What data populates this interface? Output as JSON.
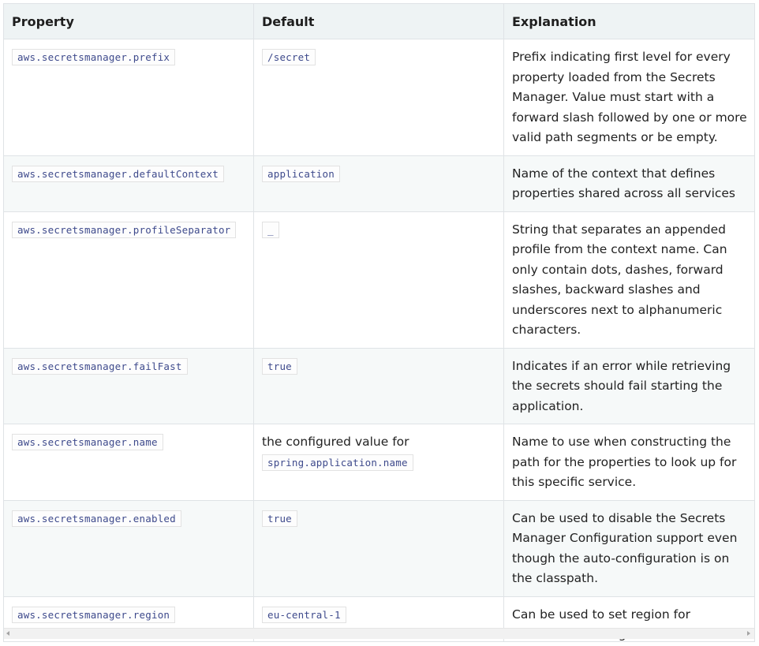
{
  "table": {
    "headers": [
      "Property",
      "Default",
      "Explanation"
    ],
    "rows": [
      {
        "property": "aws.secretsmanager.prefix",
        "default_code": "/secret",
        "explanation": "Prefix indicating first level for every property loaded from the Secrets Manager. Value must start with a forward slash followed by one or more valid path segments or be empty."
      },
      {
        "property": "aws.secretsmanager.defaultContext",
        "default_code": "application",
        "explanation": "Name of the context that defines properties shared across all services"
      },
      {
        "property": "aws.secretsmanager.profileSeparator",
        "default_code": "_",
        "explanation": "String that separates an appended profile from the context name. Can only contain dots, dashes, forward slashes, backward slashes and underscores next to alphanumeric characters."
      },
      {
        "property": "aws.secretsmanager.failFast",
        "default_code": "true",
        "explanation": "Indicates if an error while retrieving the secrets should fail starting the application."
      },
      {
        "property": "aws.secretsmanager.name",
        "default_text": "the configured value for",
        "default_code": "spring.application.name",
        "explanation": "Name to use when constructing the path for the properties to look up for this specific service."
      },
      {
        "property": "aws.secretsmanager.enabled",
        "default_code": "true",
        "explanation": "Can be used to disable the Secrets Manager Configuration support even though the auto-configuration is on the classpath."
      },
      {
        "property": "aws.secretsmanager.region",
        "default_code": "eu-central-1",
        "explanation": "Can be used to set region for AWSSecretsManagerClient."
      }
    ]
  }
}
